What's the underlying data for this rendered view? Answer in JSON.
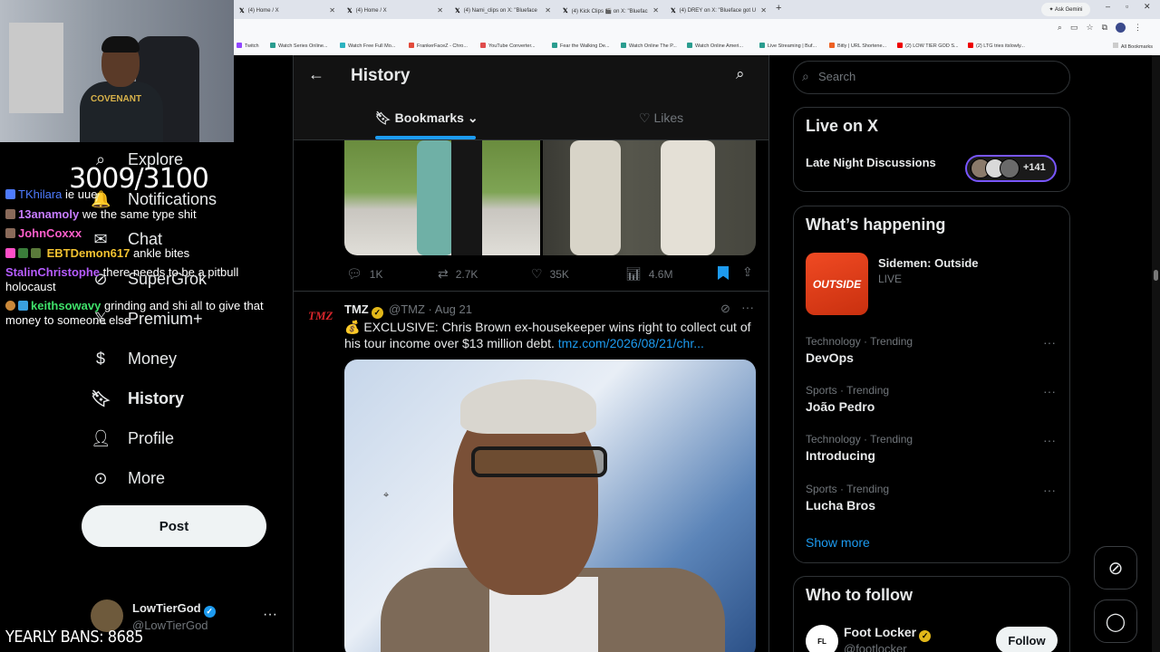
{
  "browser": {
    "tabs": [
      {
        "label": "(4) Home / X"
      },
      {
        "label": "(4) Home / X"
      },
      {
        "label": "(4) Nami_clips on X: \"Blueface"
      },
      {
        "label": "(4) Kick Clips 🎬 on X: \"Bluefac"
      },
      {
        "label": "(4) DREY on X: \"Blueface got U"
      }
    ],
    "new_tab": "+",
    "ask_gemini": "✦ Ask Gemini",
    "bookmarks": [
      "Twitch",
      "Watch Series Online...",
      "Watch Free Full Mo...",
      "FrankerFaceZ - Chro...",
      "YouTube Converter...",
      "Fear the Walking De...",
      "Watch Online The P...",
      "Watch Online Ameri...",
      "Live Streaming | Buf...",
      "Bitly | URL Shortene...",
      "(2) LOW TIER GOD S...",
      "(2) LTG tries itslowly..."
    ],
    "all_bookmarks": "All Bookmarks"
  },
  "stream": {
    "counter": "3009/3100",
    "yearly_bans": "YEARLY BANS: 8685",
    "chat": [
      {
        "user": "TKhilara",
        "msg": "ie uue",
        "color": "#4e7bff"
      },
      {
        "user": "13anamoly",
        "msg": "we the same type shit",
        "color": "#c77dff"
      },
      {
        "user": "JohnCoxxx",
        "msg": "",
        "color": "#ff5ecb"
      },
      {
        "user": "EBTDemon617",
        "msg": "ankle bites",
        "color": "#f2c230"
      },
      {
        "user": "StalinChristophe",
        "msg": "there needs to be a pitbull",
        "color": "#b65cff"
      },
      {
        "user": "",
        "msg": "holocaust",
        "color": "#ffffff"
      },
      {
        "user": "keithsowavy",
        "msg": "grinding and shi all to give that",
        "color": "#3fe06a"
      },
      {
        "user": "",
        "msg": "money to someone else",
        "color": "#ffffff"
      }
    ],
    "shirt_text": "COVENANT"
  },
  "nav": {
    "items": [
      {
        "label": "Explore",
        "icon": "search-icon"
      },
      {
        "label": "Notifications",
        "icon": "bell-icon"
      },
      {
        "label": "Chat",
        "icon": "chat-icon"
      },
      {
        "label": "SuperGrok",
        "icon": "grok-icon"
      },
      {
        "label": "Premium+",
        "icon": "x-icon"
      },
      {
        "label": "Money",
        "icon": "money-icon"
      },
      {
        "label": "History",
        "icon": "bookmark-icon"
      },
      {
        "label": "Profile",
        "icon": "person-icon"
      },
      {
        "label": "More",
        "icon": "more-icon"
      }
    ],
    "post_label": "Post"
  },
  "account": {
    "name": "LowTierGod",
    "handle": "@LowTierGod",
    "more": "···"
  },
  "main": {
    "title": "History",
    "tabs": {
      "bookmarks": "Bookmarks",
      "likes": "Likes"
    },
    "first_post": {
      "replies": "1K",
      "reposts": "2.7K",
      "likes": "35K",
      "views": "4.6M"
    },
    "tweet": {
      "logo": "TMZ",
      "name": "TMZ",
      "handle": "@TMZ",
      "date": "· Aug 21",
      "emoji": "💰",
      "text": "EXCLUSIVE: Chris Brown ex-housekeeper wins right to collect cut of his tour income over $13 million debt.",
      "link": "tmz.com/2026/08/21/chr..."
    }
  },
  "sidebar": {
    "search_placeholder": "Search",
    "live": {
      "title": "Live on X",
      "space": "Late Night Discussions",
      "count": "+141"
    },
    "happening": {
      "title": "What’s happening",
      "featured": {
        "name": "Sidemen: Outside",
        "status": "LIVE",
        "thumb_text": "OUTSIDE"
      },
      "trends": [
        {
          "category": "Technology · Trending",
          "name": "DevOps"
        },
        {
          "category": "Sports · Trending",
          "name": "João Pedro"
        },
        {
          "category": "Technology · Trending",
          "name": "Introducing"
        },
        {
          "category": "Sports · Trending",
          "name": "Lucha Bros"
        }
      ],
      "show_more": "Show more"
    },
    "who_to_follow": {
      "title": "Who to follow",
      "name": "Foot Locker",
      "handle": "@footlocker",
      "follow": "Follow"
    }
  },
  "colors": {
    "accent": "#1d9bf0",
    "background": "#000000",
    "border": "#2f3336",
    "muted": "#71767b",
    "live_ring": "#7856ff"
  }
}
